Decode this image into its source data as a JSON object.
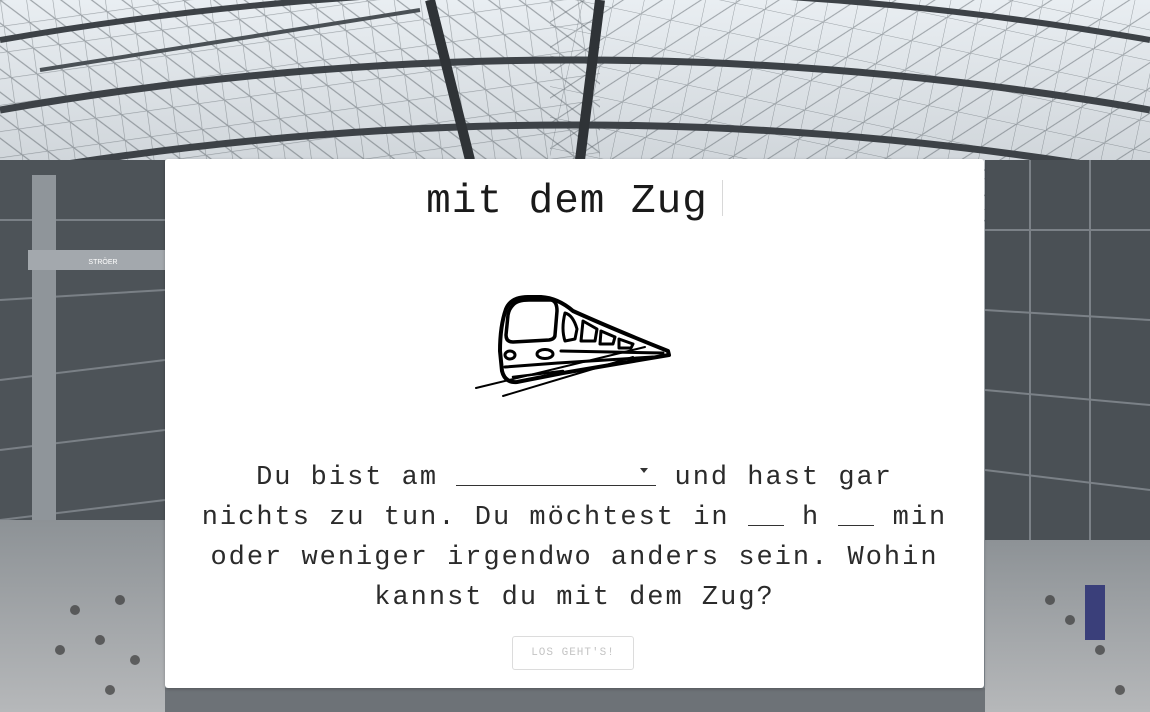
{
  "page": {
    "title": "mit dem Zug"
  },
  "icons": {
    "train": "train-icon",
    "dropdown": "chevron-down-icon"
  },
  "form": {
    "text_1": "Du bist am",
    "station_select": {
      "value": ""
    },
    "text_2": "und hast gar nichts zu tun. Du möchtest in",
    "hours_field": {
      "value": ""
    },
    "text_3": "h",
    "minutes_field": {
      "value": ""
    },
    "text_4": "min oder weniger irgendwo anders sein. Wohin kannst du mit dem Zug?"
  },
  "button": {
    "label": "LOS GEHT'S!"
  },
  "background": {
    "sign_text": "STRÖER"
  },
  "colors": {
    "card": "#ffffff",
    "text": "#2b2b2b",
    "button_text": "#c4c4c4",
    "button_border": "#dcdcdc"
  }
}
